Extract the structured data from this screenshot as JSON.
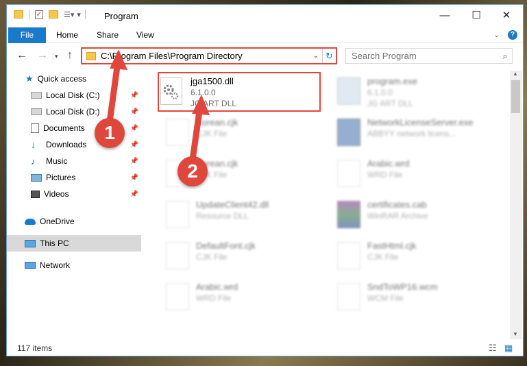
{
  "window": {
    "title": "Program",
    "controls": {
      "minimize": "—",
      "maximize": "☐",
      "close": "✕"
    }
  },
  "ribbon": {
    "tabs": [
      {
        "label": "File"
      },
      {
        "label": "Home"
      },
      {
        "label": "Share"
      },
      {
        "label": "View"
      }
    ]
  },
  "navigation": {
    "address": "C:\\Program Files\\Program Directory",
    "search_placeholder": "Search Program"
  },
  "sidebar": {
    "items": [
      {
        "label": "Quick access",
        "icon": "star-icon",
        "pinned": false
      },
      {
        "label": "Local Disk (C:)",
        "icon": "drive-icon",
        "pinned": true
      },
      {
        "label": "Local Disk (D:)",
        "icon": "drive-icon",
        "pinned": true
      },
      {
        "label": "Documents",
        "icon": "documents-icon",
        "pinned": true
      },
      {
        "label": "Downloads",
        "icon": "downloads-icon",
        "pinned": true
      },
      {
        "label": "Music",
        "icon": "music-icon",
        "pinned": true
      },
      {
        "label": "Pictures",
        "icon": "pictures-icon",
        "pinned": true
      },
      {
        "label": "Videos",
        "icon": "videos-icon",
        "pinned": true
      },
      {
        "label": "OneDrive",
        "icon": "cloud-icon",
        "pinned": false
      },
      {
        "label": "This PC",
        "icon": "computer-icon",
        "pinned": false,
        "selected": true
      },
      {
        "label": "Network",
        "icon": "network-icon",
        "pinned": false
      }
    ]
  },
  "files": [
    {
      "name": "jga1500.dll",
      "line2": "6.1.0.0",
      "line3": "JG ART DLL",
      "highlighted": true
    },
    {
      "name": "program.exe",
      "line2": "6.1.0.0",
      "line3": "JG ART DLL"
    },
    {
      "name": "Korean.cjk",
      "line2": "CJK File",
      "line3": ""
    },
    {
      "name": "NetworkLicenseServer.exe",
      "line2": "ABBYY network licens...",
      "line3": ""
    },
    {
      "name": "Korean.cjk",
      "line2": "CJK File",
      "line3": ""
    },
    {
      "name": "Arabic.wrd",
      "line2": "WRD File",
      "line3": ""
    },
    {
      "name": "UpdateClient42.dll",
      "line2": "Resource DLL",
      "line3": ""
    },
    {
      "name": "certificates.cab",
      "line2": "WinRAR Archive",
      "line3": ""
    },
    {
      "name": "DefaultFont.cjk",
      "line2": "CJK File",
      "line3": ""
    },
    {
      "name": "FastHtml.cjk",
      "line2": "CJK File",
      "line3": ""
    },
    {
      "name": "Arabic.wrd",
      "line2": "WRD File",
      "line3": ""
    },
    {
      "name": "SndToWP16.wcm",
      "line2": "WCM File",
      "line3": ""
    }
  ],
  "status": {
    "item_count": "117 items"
  },
  "annotations": {
    "step1": "1",
    "step2": "2"
  },
  "colors": {
    "accent": "#1979ca",
    "highlight": "#e0473c"
  }
}
